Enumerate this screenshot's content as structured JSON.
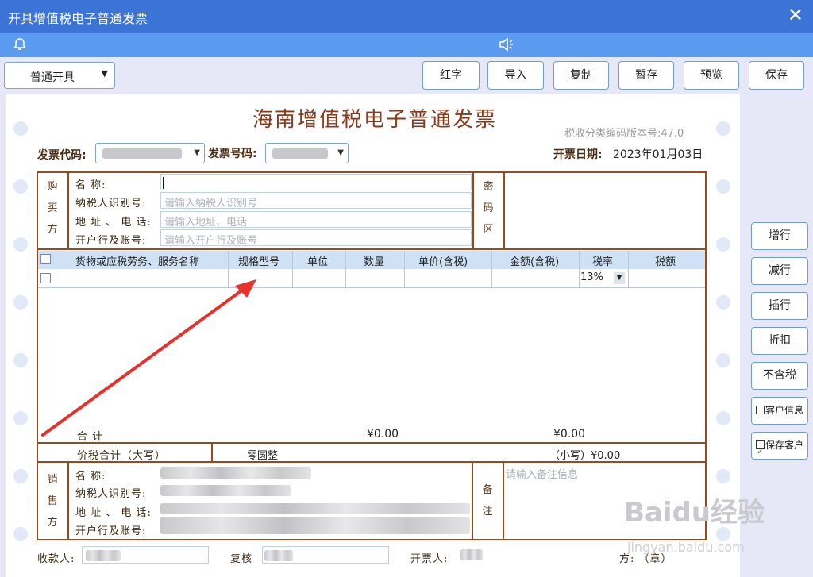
{
  "window": {
    "title": "开具增值税电子普通发票",
    "close_icon": "✕"
  },
  "toolbar": {
    "mode": "普通开具",
    "buttons": [
      "红字",
      "导入",
      "复制",
      "暂存",
      "预览",
      "保存"
    ]
  },
  "invoice": {
    "title": "海南增值税电子普通发票",
    "version": "税收分类编码版本号:47.0",
    "code_label": "发票代码:",
    "number_label": "发票号码:",
    "date_label": "开票日期:",
    "date_value": "2023年01月03日"
  },
  "buyer": {
    "section_label": [
      "购",
      "买",
      "方"
    ],
    "name_label": "名    称:",
    "taxid_label": "纳税人识别号:",
    "taxid_placeholder": "请输入纳税人识别号",
    "address_label": "地 址 、 电 话:",
    "address_placeholder": "请输入地址、电话",
    "bank_label": "开户行及账号:",
    "bank_placeholder": "请输入开户行及账号",
    "cipher_label": [
      "密",
      "码",
      "区"
    ]
  },
  "table": {
    "headers": [
      "货物或应税劳务、服务名称",
      "规格型号",
      "单位",
      "数量",
      "单价(含税)",
      "金额(含税)",
      "税率",
      "税额"
    ],
    "row_tax_rate": "13%",
    "total_label": "合              计",
    "total_amount": "¥0.00",
    "total_tax": "¥0.00",
    "price_tax_total_label": "价税合计（大写）",
    "price_tax_total_upper": "零圆整",
    "price_tax_total_lower": "（小写）¥0.00"
  },
  "seller": {
    "section_label": [
      "销",
      "售",
      "方"
    ],
    "name_label": "名    称:",
    "taxid_label": "纳税人识别号:",
    "address_label": "地 址 、 电 话:",
    "bank_label": "开户行及账号:",
    "remark_label": [
      "备",
      "注"
    ],
    "remark_placeholder": "请输入备注信息"
  },
  "side_buttons": [
    "增行",
    "减行",
    "插行",
    "折扣",
    "不含税",
    "客户信息",
    "保存客户"
  ],
  "footer": {
    "payee_label": "收款人:",
    "reviewer_label": "复核",
    "drawer_label": "开票人:",
    "seller_stamp_label": "方:  （章）"
  },
  "watermark": {
    "text": "Baidu经验",
    "url": "jingyan.baidu.com"
  },
  "colors": {
    "titlebar": "#3b74d6",
    "notifybar": "#5b9bef",
    "border": "#9a4a1a",
    "title": "#8b3a1a",
    "annotation_arrow": "#e8312a"
  }
}
